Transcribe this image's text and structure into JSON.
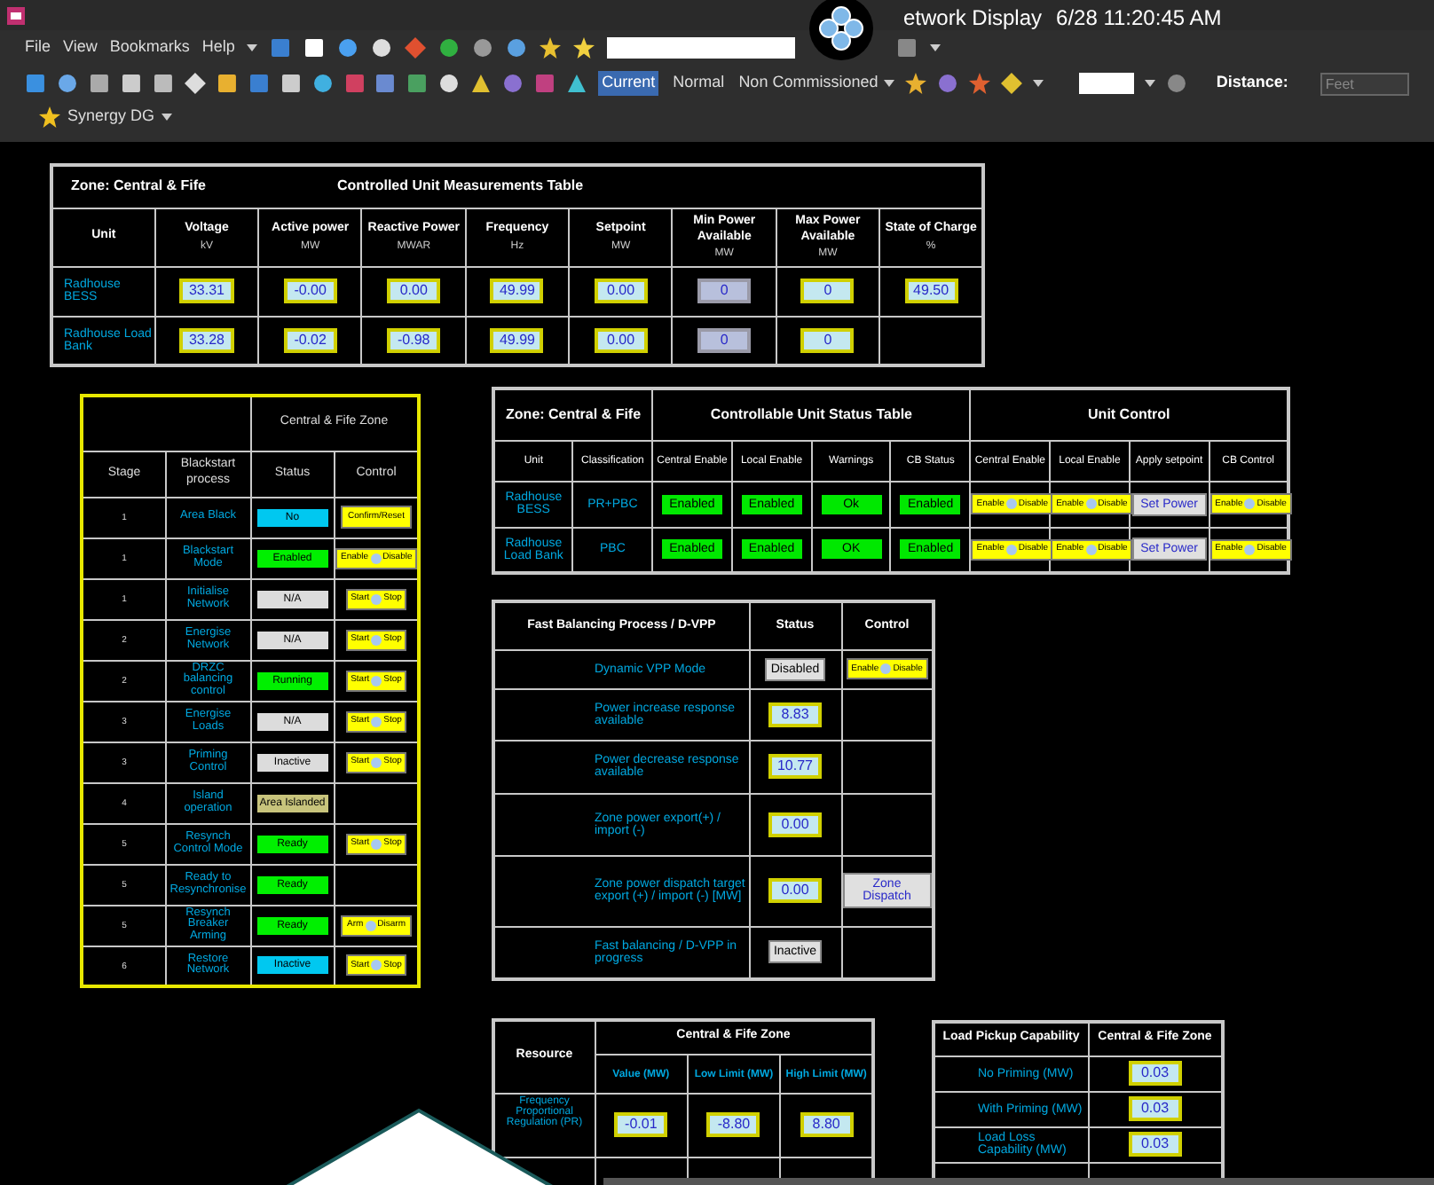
{
  "window": {
    "title": "etwork Display",
    "datetime": "6/28 11:20:45 AM"
  },
  "menu": [
    "File",
    "View",
    "Bookmarks",
    "Help"
  ],
  "toolbar": {
    "modes": [
      {
        "label": "Current",
        "selected": true
      },
      {
        "label": "Normal",
        "selected": false
      }
    ],
    "filter": "Non Commissioned",
    "distance_label": "Distance:",
    "distance_placeholder": "Feet",
    "bookmark": "Synergy DG"
  },
  "measurements": {
    "zone": "Zone: Central & Fife",
    "title": "Controlled Unit Measurements Table",
    "unit_column": "Unit",
    "columns": [
      {
        "name": "Voltage",
        "unit": "kV"
      },
      {
        "name": "Active power",
        "unit": "MW"
      },
      {
        "name": "Reactive Power",
        "unit": "MWAR"
      },
      {
        "name": "Frequency",
        "unit": "Hz"
      },
      {
        "name": "Setpoint",
        "unit": "MW"
      },
      {
        "name": "Min Power Available",
        "unit": "MW"
      },
      {
        "name": "Max Power Available",
        "unit": "MW"
      },
      {
        "name": "State of Charge",
        "unit": "%"
      }
    ],
    "rows": [
      {
        "unit": "Radhouse BESS",
        "cells": [
          {
            "value": "33.31",
            "disabled": false
          },
          {
            "value": "-0.00",
            "disabled": false
          },
          {
            "value": "0.00",
            "disabled": false
          },
          {
            "value": "49.99",
            "disabled": false
          },
          {
            "value": "0.00",
            "disabled": false
          },
          {
            "value": "0",
            "disabled": true
          },
          {
            "value": "0",
            "disabled": false
          },
          {
            "value": "49.50",
            "disabled": false
          }
        ]
      },
      {
        "unit": "Radhouse Load Bank",
        "cells": [
          {
            "value": "33.28",
            "disabled": false
          },
          {
            "value": "-0.02",
            "disabled": false
          },
          {
            "value": "-0.98",
            "disabled": false
          },
          {
            "value": "49.99",
            "disabled": false
          },
          {
            "value": "0.00",
            "disabled": false
          },
          {
            "value": "0",
            "disabled": true
          },
          {
            "value": "0",
            "disabled": false
          }
        ]
      }
    ]
  },
  "blackstart": {
    "zone": "Central & Fife Zone",
    "columns": [
      "Stage",
      "Blackstart process",
      "Status",
      "Control"
    ],
    "rows": [
      {
        "stage": "1",
        "process": "Area Black",
        "status": {
          "text": "No",
          "color": "#00c8f0"
        },
        "control": {
          "kind": "action",
          "label": "Confirm/Reset"
        }
      },
      {
        "stage": "1",
        "process": "Blackstart Mode",
        "status": {
          "text": "Enabled",
          "color": "#00f000"
        },
        "control": {
          "kind": "toggle",
          "left": "Enable",
          "right": "Disable"
        }
      },
      {
        "stage": "1",
        "process": "Initialise Network",
        "status": {
          "text": "N/A",
          "color": "#dcdcdc"
        },
        "control": {
          "kind": "toggle",
          "left": "Start",
          "right": "Stop"
        }
      },
      {
        "stage": "2",
        "process": "Energise Network",
        "status": {
          "text": "N/A",
          "color": "#dcdcdc"
        },
        "control": {
          "kind": "toggle",
          "left": "Start",
          "right": "Stop"
        }
      },
      {
        "stage": "2",
        "process": "DRZC balancing control",
        "status": {
          "text": "Running",
          "color": "#00f000"
        },
        "control": {
          "kind": "toggle",
          "left": "Start",
          "right": "Stop"
        }
      },
      {
        "stage": "3",
        "process": "Energise Loads",
        "status": {
          "text": "N/A",
          "color": "#dcdcdc"
        },
        "control": {
          "kind": "toggle",
          "left": "Start",
          "right": "Stop"
        }
      },
      {
        "stage": "3",
        "process": "Priming Control",
        "status": {
          "text": "Inactive",
          "color": "#dcdcdc"
        },
        "control": {
          "kind": "toggle",
          "left": "Start",
          "right": "Stop"
        }
      },
      {
        "stage": "4",
        "process": "Island operation",
        "status": {
          "text": "Area Islanded",
          "color": "#c8c47c"
        }
      },
      {
        "stage": "5",
        "process": "Resynch Control Mode",
        "status": {
          "text": "Ready",
          "color": "#00f000"
        },
        "control": {
          "kind": "toggle",
          "left": "Start",
          "right": "Stop"
        }
      },
      {
        "stage": "5",
        "process": "Ready to Resynchronise",
        "status": {
          "text": "Ready",
          "color": "#00f000"
        }
      },
      {
        "stage": "5",
        "process": "Resynch Breaker Arming",
        "status": {
          "text": "Ready",
          "color": "#00f000"
        },
        "control": {
          "kind": "toggle",
          "left": "Arm",
          "right": "Disarm"
        }
      },
      {
        "stage": "6",
        "process": "Restore Network",
        "status": {
          "text": "Inactive",
          "color": "#00c8f0"
        },
        "control": {
          "kind": "toggle",
          "left": "Start",
          "right": "Stop"
        }
      }
    ]
  },
  "unit_status": {
    "zone": "Zone: Central & Fife",
    "title": "Controllable Unit Status Table",
    "control_title": "Unit Control",
    "columns": [
      "Unit",
      "Classification",
      "Central Enable",
      "Local Enable",
      "Warnings",
      "CB Status",
      "Central Enable",
      "Local Enable",
      "Apply setpoint",
      "CB Control"
    ],
    "rows": [
      {
        "unit": "Radhouse BESS",
        "classification": "PR+PBC",
        "states": [
          "Enabled",
          "Enabled",
          "Ok",
          "Enabled"
        ],
        "controls": [
          {
            "kind": "toggle",
            "left": "Enable",
            "right": "Disable"
          },
          {
            "kind": "toggle",
            "left": "Enable",
            "right": "Disable"
          },
          {
            "kind": "command",
            "label": "Set Power"
          },
          {
            "kind": "toggle",
            "left": "Enable",
            "right": "Disable"
          }
        ]
      },
      {
        "unit": "Radhouse Load Bank",
        "classification": "PBC",
        "states": [
          "Enabled",
          "Enabled",
          "OK",
          "Enabled"
        ],
        "controls": [
          {
            "kind": "toggle",
            "left": "Enable",
            "right": "Disable"
          },
          {
            "kind": "toggle",
            "left": "Enable",
            "right": "Disable"
          },
          {
            "kind": "command",
            "label": "Set Power"
          },
          {
            "kind": "toggle",
            "left": "Enable",
            "right": "Disable"
          }
        ]
      }
    ]
  },
  "fast_balancing": {
    "columns": [
      "Fast Balancing Process / D-VPP",
      "Status",
      "Control"
    ],
    "rows": [
      {
        "label": "Dynamic VPP Mode",
        "status": {
          "kind": "state",
          "text": "Disabled"
        },
        "control": {
          "kind": "toggle",
          "left": "Enable",
          "right": "Disable"
        }
      },
      {
        "label": "Power increase response available",
        "status": {
          "kind": "value",
          "text": "8.83"
        }
      },
      {
        "label": "Power decrease response available",
        "status": {
          "kind": "value",
          "text": "10.77"
        }
      },
      {
        "label": "Zone power export(+) / import (-)",
        "status": {
          "kind": "value",
          "text": "0.00"
        }
      },
      {
        "label": "Zone power dispatch target export (+) / import (-) [MW]",
        "status": {
          "kind": "value",
          "text": "0.00"
        },
        "control": {
          "kind": "command",
          "label": "Zone Dispatch"
        }
      },
      {
        "label": "Fast balancing / D-VPP in progress",
        "status": {
          "kind": "state",
          "text": "Inactive"
        }
      }
    ]
  },
  "resources": {
    "resource_header": "Resource",
    "zone": "Central & Fife Zone",
    "columns": [
      "Value (MW)",
      "Low Limit (MW)",
      "High Limit (MW)"
    ],
    "rows": [
      {
        "name": "Frequency Proportional Regulation (PR)",
        "values": [
          "-0.01",
          "-8.80",
          "8.80"
        ]
      }
    ]
  },
  "load_pickup": {
    "columns": [
      "Load Pickup Capability",
      "Central & Fife Zone"
    ],
    "rows": [
      {
        "name": "No Priming (MW)",
        "value": "0.03"
      },
      {
        "name": "With Priming (MW)",
        "value": "0.03"
      },
      {
        "name": "Load Loss Capability (MW)",
        "value": "0.03"
      }
    ]
  }
}
